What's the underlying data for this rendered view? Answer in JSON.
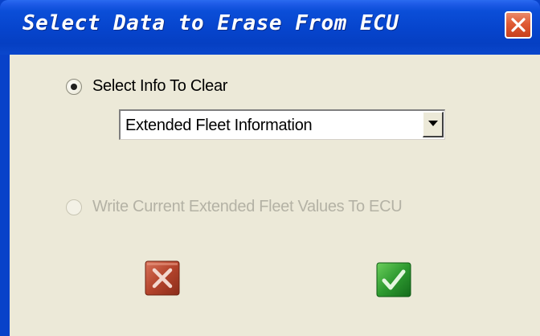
{
  "window": {
    "title": "Select Data to Erase From ECU"
  },
  "options": {
    "select_info_label": "Select Info To Clear",
    "select_info_checked": true,
    "write_values_label": "Write Current Extended Fleet Values To ECU",
    "write_values_enabled": false
  },
  "combo": {
    "selected_value": "Extended Fleet Information"
  },
  "buttons": {
    "cancel_icon": "red-x-icon",
    "ok_icon": "green-check-icon"
  },
  "colors": {
    "titlebar": "#0644cc",
    "client_bg": "#ece9d8",
    "close_button": "#e05a34",
    "cancel_button": "#b0402a",
    "ok_button": "#2e8c2e",
    "disabled_text": "#b4b2a5"
  }
}
